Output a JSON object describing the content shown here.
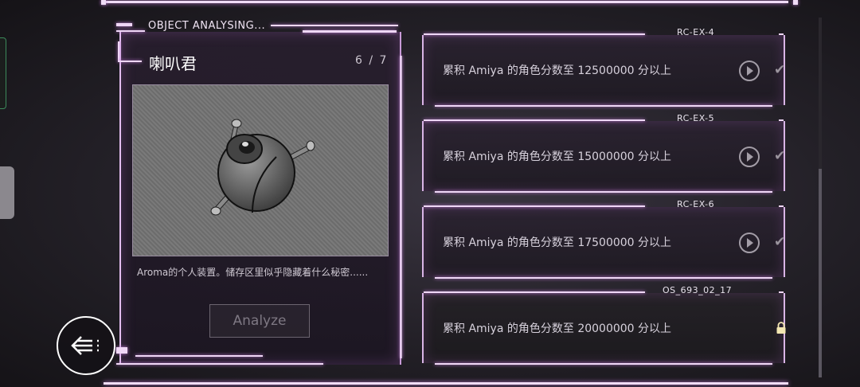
{
  "header": {
    "title": "OBJECT ANALYSING..."
  },
  "object": {
    "name": "喇叭君",
    "index": "6 / 7",
    "image_icon": "speaker-robot-sphere",
    "description": "Aroma的个人装置。储存区里似乎隐藏着什么秘密......",
    "analyze_label": "Analyze"
  },
  "back_icon": "back-arrow-icon",
  "missions": [
    {
      "code": "RC-EX-4",
      "text": "累积 Amiya 的角色分数至 12500000 分以上",
      "state": "completed"
    },
    {
      "code": "RC-EX-5",
      "text": "累积 Amiya 的角色分数至 15000000 分以上",
      "state": "completed"
    },
    {
      "code": "RC-EX-6",
      "text": "累积 Amiya 的角色分数至 17500000 分以上",
      "state": "completed"
    },
    {
      "code": "OS_693_02_17",
      "text": "累积 Amiya 的角色分数至 20000000 分以上",
      "state": "locked"
    }
  ],
  "colors": {
    "accent_glow": "#c47fd9",
    "line": "#efd7f6",
    "lock": "#f3e7b2"
  }
}
